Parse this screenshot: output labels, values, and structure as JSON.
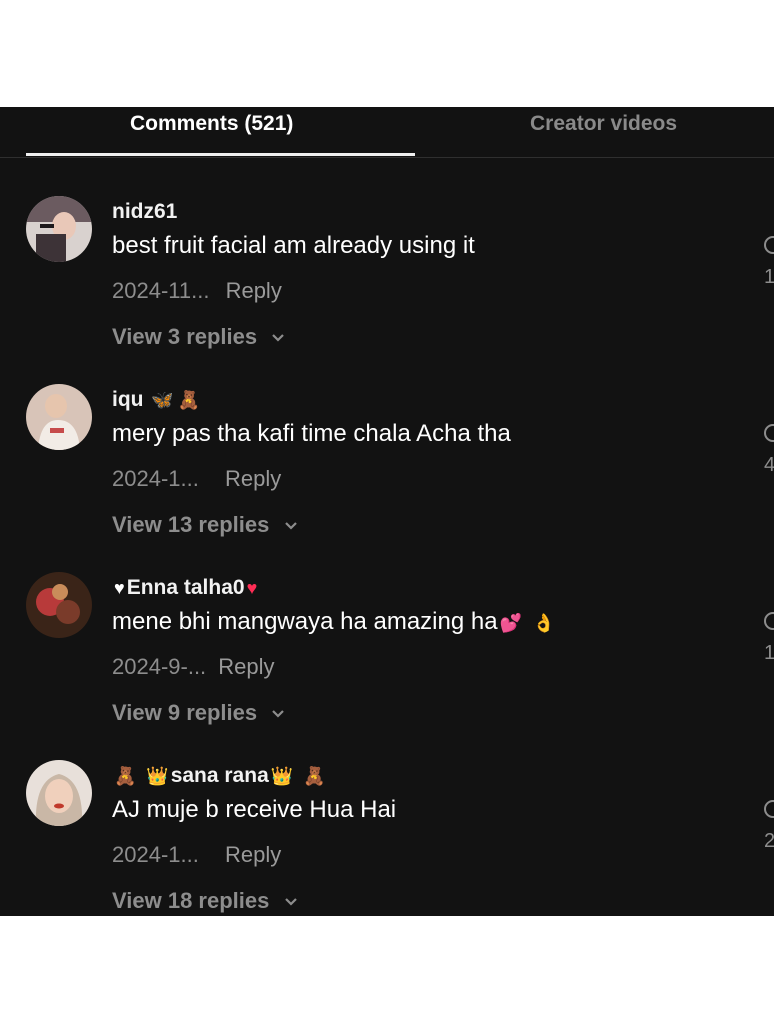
{
  "tabs": {
    "comments": "Comments (521)",
    "creator_videos": "Creator videos"
  },
  "comments": [
    {
      "username": "nidz61",
      "text": "best fruit facial am already using it",
      "date": "2024-11...",
      "reply": "Reply",
      "view_replies": "View 3 replies",
      "like_count": "1"
    },
    {
      "username": "iqu",
      "text": "mery pas tha kafi time chala Acha tha",
      "date": "2024-1...",
      "reply": "Reply",
      "view_replies": "View 13 replies",
      "like_count": "4"
    },
    {
      "username": "Enna talha0",
      "text": "mene bhi mangwaya ha amazing ha",
      "date": "2024-9-...",
      "reply": "Reply",
      "view_replies": "View 9 replies",
      "like_count": "1"
    },
    {
      "username": "sana rana",
      "text": "AJ muje b receive Hua Hai",
      "date": "2024-1...",
      "reply": "Reply",
      "view_replies": "View 18 replies",
      "like_count": "2"
    }
  ],
  "icons": {
    "reply_expand": "chevron-down-icon",
    "like": "heart-icon"
  },
  "colors": {
    "background": "#121212",
    "text": "#ffffff",
    "muted": "#8d8d8d"
  }
}
